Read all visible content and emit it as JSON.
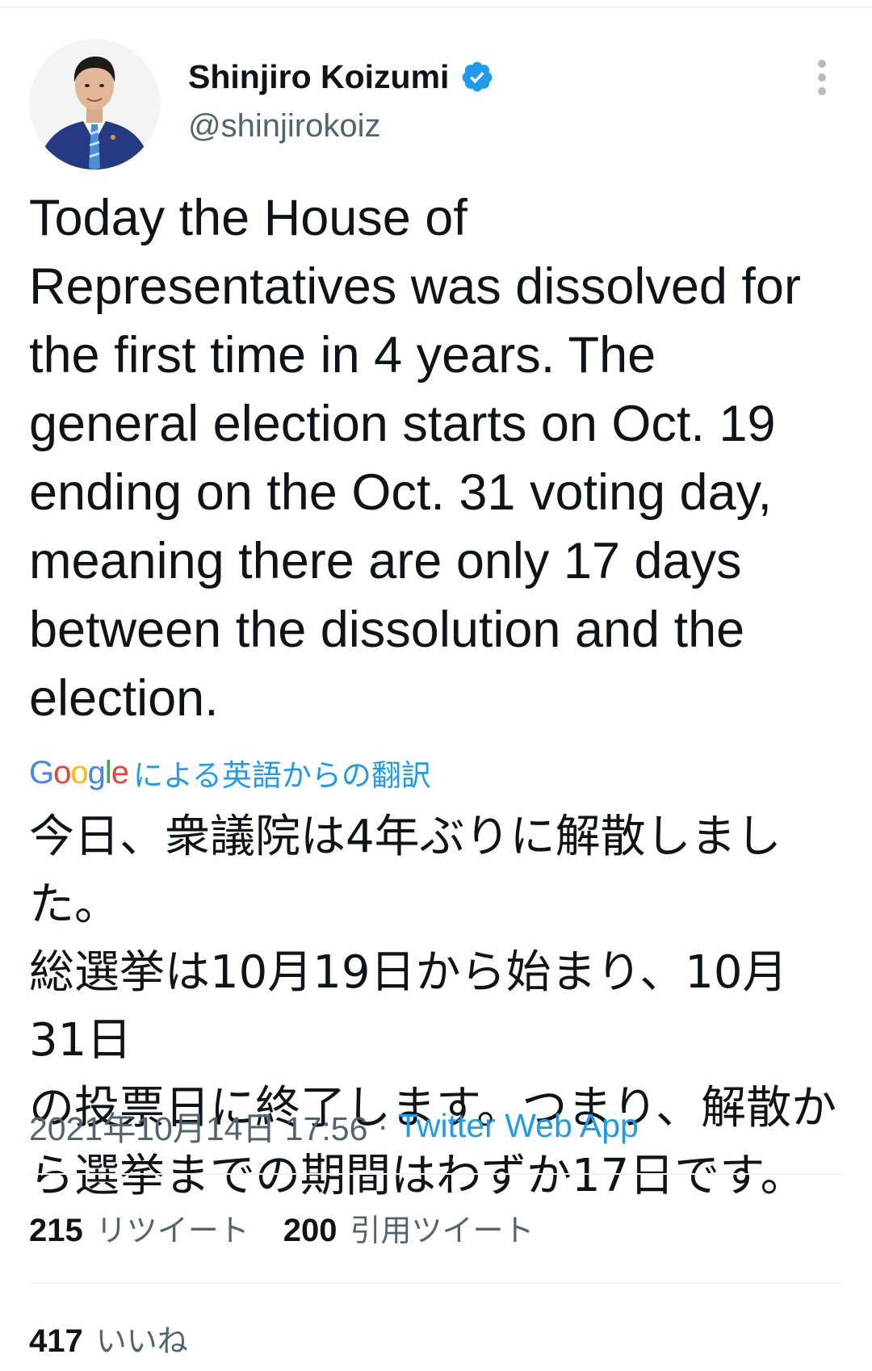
{
  "author": {
    "display_name": "Shinjiro Koizumi",
    "handle": "@shinjirokoiz",
    "verified": true,
    "verified_icon": "verified-badge-icon",
    "avatar": "profile-photo"
  },
  "menu_icon": "more-options-icon",
  "tweet": {
    "text": "Today the House of\nRepresentatives was dissolved for\nthe first time in 4 years. The\ngeneral election starts on Oct. 19\nending on the Oct. 31 voting day,\nmeaning there are only 17 days\nbetween the dissolution and the\nelection."
  },
  "translation": {
    "provider_logo": "Google",
    "label": "による英語からの翻訳",
    "text": "今日、衆議院は4年ぶりに解散しました。\n総選挙は10月19日から始まり、10月31日\nの投票日に終了します。つまり、解散か\nら選挙までの期間はわずか17日です。"
  },
  "meta": {
    "timestamp": "2021年10月14日 17:56",
    "separator": "·",
    "source": "Twitter Web App"
  },
  "stats": {
    "retweets_count": "215",
    "retweets_label": "リツイート",
    "quotes_count": "200",
    "quotes_label": "引用ツイート",
    "likes_count": "417",
    "likes_label": "いいね"
  },
  "colors": {
    "accent": "#1d9bf0",
    "text_primary": "#0f1419",
    "text_secondary": "#536471",
    "divider": "#eff3f4"
  }
}
